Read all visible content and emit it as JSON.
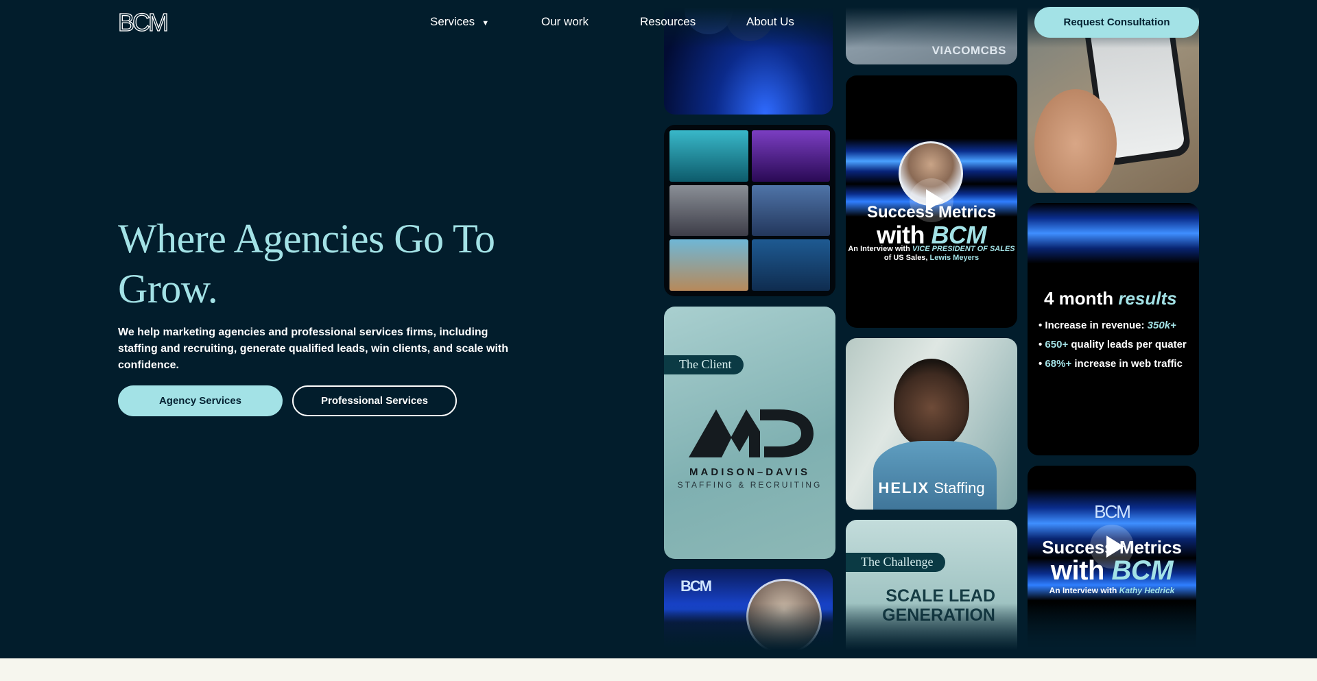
{
  "header": {
    "logo_text": "BCM",
    "nav": [
      {
        "label": "Services",
        "has_dropdown": true
      },
      {
        "label": "Our work",
        "has_dropdown": false
      },
      {
        "label": "Resources",
        "has_dropdown": false
      },
      {
        "label": "About Us",
        "has_dropdown": false
      }
    ],
    "cta_label": "Request Consultation"
  },
  "hero": {
    "headline": "Where Agencies Go To Grow.",
    "subtext": "We help marketing agencies and professional services firms, including staffing and recruiting, generate qualified leads, win clients, and scale with confidence.",
    "buttons": {
      "agency_label": "Agency Services",
      "professional_label": "Professional Services"
    }
  },
  "gallery": {
    "viacom_label": "VIACOMCBS",
    "success_metrics_1": {
      "title_line1": "Success Metrics",
      "title_line2a": "with ",
      "title_line2b": "BCM",
      "subtitle_a": "An Interview with ",
      "subtitle_b": "VICE PRESIDENT OF SALES",
      "subtitle_c": "of US Sales, ",
      "subtitle_d": "Lewis Meyers"
    },
    "client_card": {
      "tag": "The Client",
      "company": "MADISON–DAVIS",
      "company_sub": "STAFFING & RECRUITING"
    },
    "helix_card": {
      "brand_bold": "HELIX",
      "brand_light": " Staffing"
    },
    "results_card": {
      "title_a": "4 month ",
      "title_b": "results",
      "items": [
        {
          "prefix": "• Increase in revenue: ",
          "value": "350k+",
          "suffix": ""
        },
        {
          "prefix": "• ",
          "value": "650+",
          "suffix": " quality leads per quater"
        },
        {
          "prefix": "• ",
          "value": "68%+",
          "suffix": " increase in web traffic"
        }
      ]
    },
    "challenge_card": {
      "tag": "The Challenge",
      "line1": "SCALE LEAD",
      "line2": "GENERATION"
    },
    "success_metrics_2": {
      "logo": "BCM",
      "title_line1": "Success Metrics",
      "title_line2a": "with ",
      "title_line2b": "BCM",
      "subtitle_a": "An Interview with ",
      "subtitle_b": "Kathy Hedrick"
    },
    "small_logo": "BCM"
  },
  "colors": {
    "background": "#021d2c",
    "accent": "#a3e2e6",
    "strip": "#f6f6ee"
  }
}
